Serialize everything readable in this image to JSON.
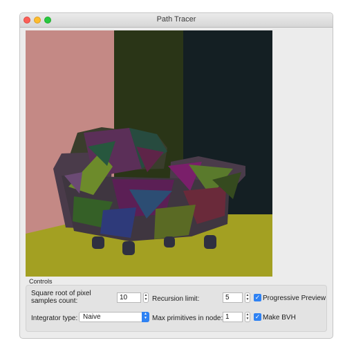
{
  "window": {
    "title": "Path Tracer"
  },
  "render": {
    "colors": {
      "left_wall": "#c48985",
      "middle_wall": "#2a3517",
      "right_wall": "#141f23",
      "floor": "#a3a022"
    }
  },
  "controls": {
    "group_label": "Controls",
    "samples_label": "Square root of pixel samples count:",
    "samples_value": "10",
    "recursion_label": "Recursion limit:",
    "recursion_value": "5",
    "progressive_label": "Progressive Preview",
    "progressive_checked": true,
    "integrator_label": "Integrator type:",
    "integrator_value": "Naive",
    "max_primitives_label": "Max primitives in node:",
    "max_primitives_value": "1",
    "bvh_label": "Make BVH",
    "bvh_checked": true,
    "accent_color": "#2f82f3"
  }
}
